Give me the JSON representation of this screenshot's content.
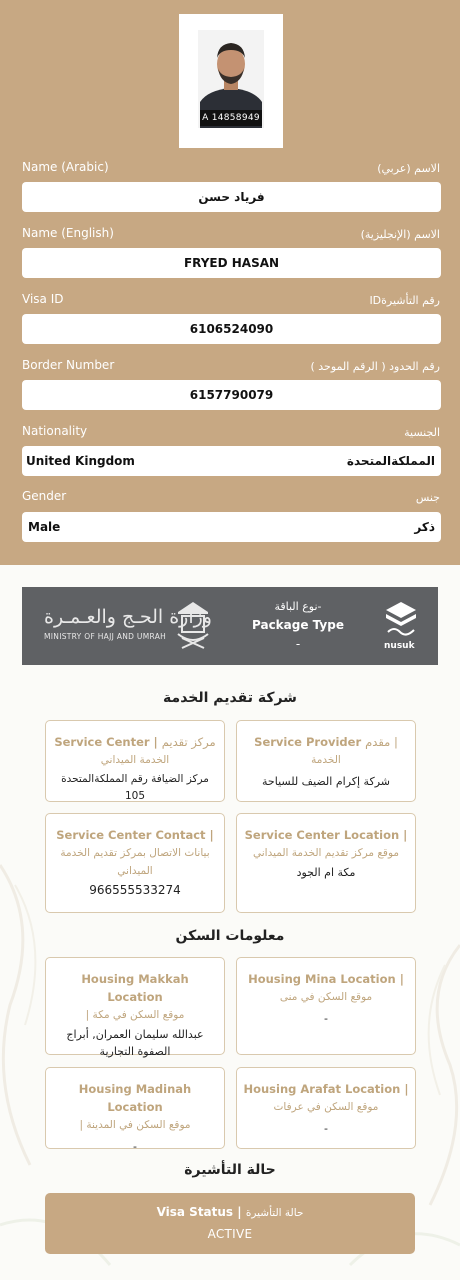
{
  "photo": {
    "id_caption": "A 14858949"
  },
  "fields": [
    {
      "label_en": "Name (Arabic)",
      "label_ar": "الاسم (عربي)",
      "value": "فرياد حسن"
    },
    {
      "label_en": "Name (English)",
      "label_ar": "الاسم (الإنجليزية)",
      "value": "FRYED HASAN"
    },
    {
      "label_en": "Visa ID",
      "label_ar": "رقم التأشيرةID",
      "value": "6106524090"
    },
    {
      "label_en": "Border Number",
      "label_ar": "رقم الحدود ( الرقم الموحد )",
      "value": "6157790079"
    },
    {
      "label_en": "Nationality",
      "label_ar": "الجنسية",
      "value_en": "United Kingdom",
      "value_ar": "المملكةالمتحدة"
    },
    {
      "label_en": "Gender",
      "label_ar": "جنس",
      "value_en": "Male",
      "value_ar": "ذكر"
    }
  ],
  "banner": {
    "ministry_ar": "وزارة الحـج والعـمـرة",
    "ministry_en": "MINISTRY OF HAJJ AND UMRAH",
    "package_label_ar": "-نوع الباقة",
    "package_label_en": "Package Type",
    "package_value": "-",
    "nusuk": "nusuk"
  },
  "service": {
    "title": "شركة تقديم الخدمة",
    "cards": [
      {
        "en": "Service Provider",
        "ar_top": "مقدم |",
        "ar": "الخدمة",
        "value": "شركة إكرام الضيف للسياحة"
      },
      {
        "en": "Service Center |",
        "ar_top": "مركز تقديم",
        "ar": "الخدمة الميداني",
        "value": "مركز الضيافة رقم المملكةالمتحدة 105"
      },
      {
        "en": "Service Center Location |",
        "ar": "موقع مركز تقديم الخدمة الميداني",
        "value": "مكة ام الجود"
      },
      {
        "en": "Service Center Contact |",
        "ar": "بيانات الاتصال بمركز تقديم الخدمة الميداني",
        "value": "966555533274"
      }
    ]
  },
  "housing": {
    "title": "معلومات السكن",
    "cards": [
      {
        "en": "Housing Mina Location |",
        "ar": "موقع السكن في منى",
        "value": "-"
      },
      {
        "en": "Housing Makkah Location",
        "ar": "موقع السكن في مكة |",
        "value": "عبدالله سليمان العمران, أبراج الصفوة التجارية"
      },
      {
        "en": "Housing Arafat Location |",
        "ar": "موقع السكن في عرفات",
        "value": "-"
      },
      {
        "en": "Housing Madinah Location",
        "ar": "موقع السكن في المدينة |",
        "value": "-"
      }
    ]
  },
  "visa": {
    "title": "حالة التأشيرة",
    "label_en": "Visa Status |",
    "label_ar": "حالة التأشيرة",
    "value": "ACTIVE"
  }
}
